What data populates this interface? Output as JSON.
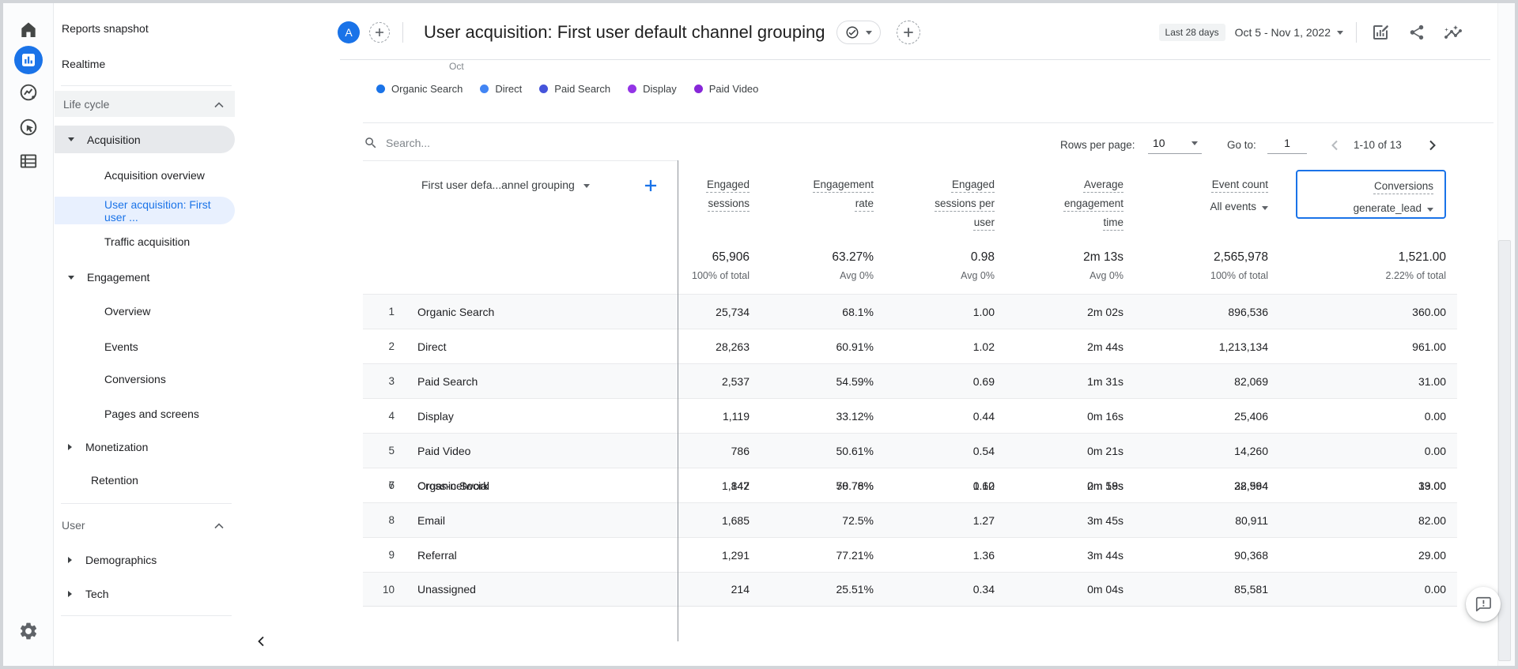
{
  "header": {
    "avatar_letter": "A",
    "title": "User acquisition: First user default channel grouping",
    "date_preset": "Last 28 days",
    "date_range": "Oct 5 - Nov 1, 2022"
  },
  "rail_icons": [
    "home",
    "reports",
    "explore",
    "advertising",
    "library",
    "admin-settings"
  ],
  "sidebar": {
    "reports_snapshot": "Reports snapshot",
    "realtime": "Realtime",
    "life_cycle": "Life cycle",
    "acquisition": "Acquisition",
    "acquisition_overview": "Acquisition overview",
    "user_acquisition": "User acquisition: First user ...",
    "traffic_acquisition": "Traffic acquisition",
    "engagement": "Engagement",
    "engagement_overview": "Overview",
    "events": "Events",
    "conversions": "Conversions",
    "pages_and_screens": "Pages and screens",
    "monetization": "Monetization",
    "retention": "Retention",
    "user": "User",
    "demographics": "Demographics",
    "tech": "Tech"
  },
  "chart": {
    "axis_label": "Oct",
    "legend": [
      {
        "label": "Organic Search",
        "color": "#1a73e8"
      },
      {
        "label": "Direct",
        "color": "#4285f4"
      },
      {
        "label": "Paid Search",
        "color": "#4554db"
      },
      {
        "label": "Display",
        "color": "#9334e6"
      },
      {
        "label": "Paid Video",
        "color": "#8727d8"
      }
    ]
  },
  "toolbar": {
    "search_placeholder": "Search...",
    "rows_per_page_label": "Rows per page:",
    "rows_per_page_value": "10",
    "goto_label": "Go to:",
    "goto_value": "1",
    "pagination_text": "1-10 of 13"
  },
  "table": {
    "dimension_header": "First user defa...annel grouping",
    "columns": [
      {
        "title": "Engaged sessions"
      },
      {
        "title": "Engagement rate"
      },
      {
        "title": "Engaged sessions per user"
      },
      {
        "title": "Average engagement time"
      },
      {
        "title": "Event count",
        "filter": "All events"
      },
      {
        "title": "Conversions",
        "filter": "generate_lead",
        "highlighted": true,
        "highlight_color": "#1a73e8"
      }
    ],
    "totals": {
      "values": [
        "65,906",
        "63.27%",
        "0.98",
        "2m 13s",
        "2,565,978",
        "1,521.00"
      ],
      "notes": [
        "100% of total",
        "Avg 0%",
        "Avg 0%",
        "Avg 0%",
        "100% of total",
        "2.22% of total"
      ]
    },
    "rows": [
      {
        "num": "1",
        "channel": "Organic Search",
        "values": [
          "25,734",
          "68.1%",
          "1.00",
          "2m 02s",
          "896,536",
          "360.00"
        ]
      },
      {
        "num": "2",
        "channel": "Direct",
        "values": [
          "28,263",
          "60.91%",
          "1.02",
          "2m 44s",
          "1,213,134",
          "961.00"
        ]
      },
      {
        "num": "3",
        "channel": "Paid Search",
        "values": [
          "2,537",
          "54.59%",
          "0.69",
          "1m 31s",
          "82,069",
          "31.00"
        ]
      },
      {
        "num": "4",
        "channel": "Display",
        "values": [
          "1,119",
          "33.12%",
          "0.44",
          "0m 16s",
          "25,406",
          "0.00"
        ]
      },
      {
        "num": "5",
        "channel": "Paid Video",
        "values": [
          "786",
          "50.61%",
          "0.54",
          "0m 21s",
          "14,260",
          "0.00"
        ]
      },
      {
        "num": "6",
        "channel": "Cross-network",
        "values": [
          "847",
          "50.78%",
          "0.60",
          "0m 58s",
          "22,564",
          "19.00"
        ]
      },
      {
        "num": "7",
        "channel": "Organic Social",
        "values": [
          "1,142",
          "78.76%",
          "1.12",
          "2m 19s",
          "38,994",
          "33.00"
        ]
      },
      {
        "num": "8",
        "channel": "Email",
        "values": [
          "1,685",
          "72.5%",
          "1.27",
          "3m 45s",
          "80,911",
          "82.00"
        ]
      },
      {
        "num": "9",
        "channel": "Referral",
        "values": [
          "1,291",
          "77.21%",
          "1.36",
          "3m 44s",
          "90,368",
          "29.00"
        ]
      },
      {
        "num": "10",
        "channel": "Unassigned",
        "values": [
          "214",
          "25.51%",
          "0.34",
          "0m 04s",
          "85,581",
          "0.00"
        ]
      }
    ]
  }
}
